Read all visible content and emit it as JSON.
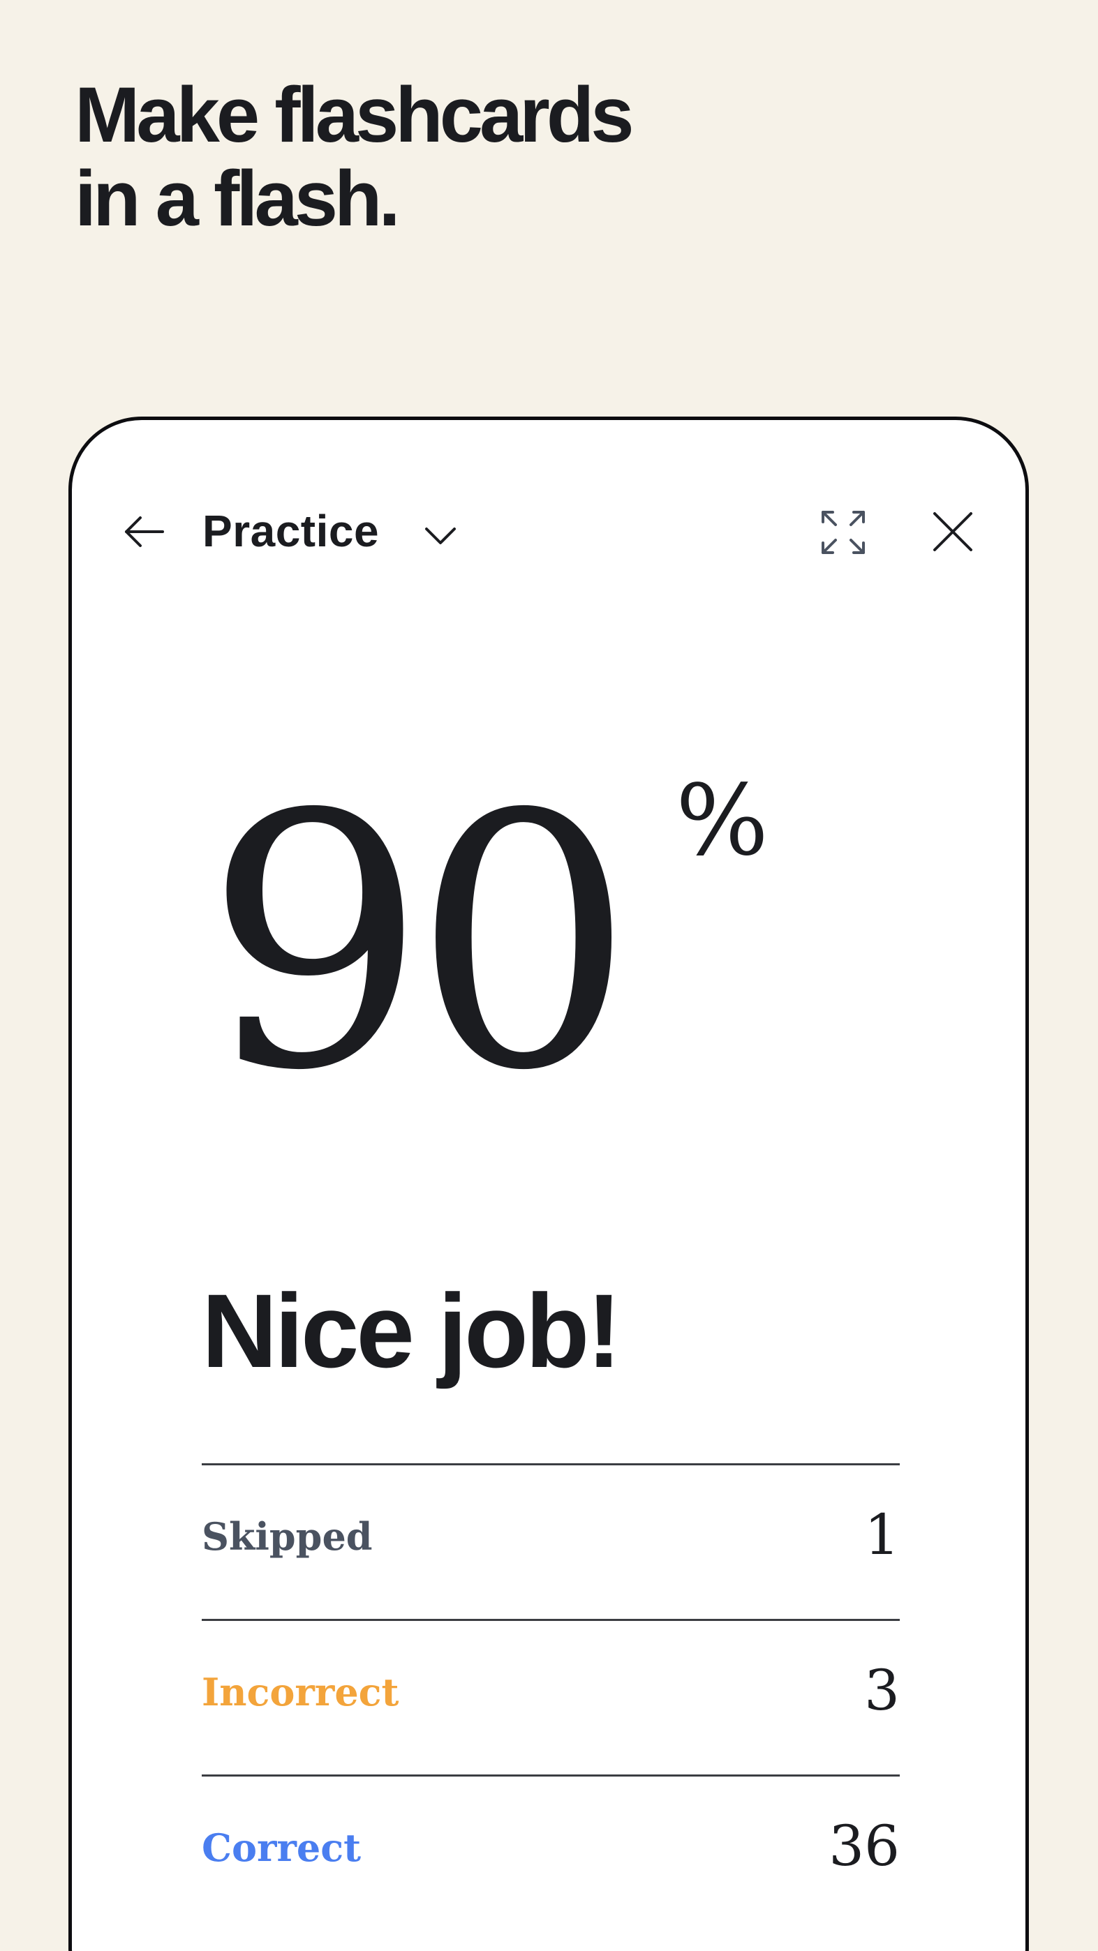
{
  "headline": {
    "line1": "Make flashcards",
    "line2": "in a flash."
  },
  "header": {
    "back_icon": "arrow-left-icon",
    "title": "Practice",
    "dropdown_icon": "chevron-down-icon",
    "expand_icon": "expand-icon",
    "close_icon": "close-icon"
  },
  "result": {
    "score": "90",
    "unit": "%",
    "message": "Nice job!"
  },
  "stats": [
    {
      "label": "Skipped",
      "value": "1",
      "color": "#4a5260"
    },
    {
      "label": "Incorrect",
      "value": "3",
      "color": "#f3a43b"
    },
    {
      "label": "Correct",
      "value": "36",
      "color": "#4a7ef0"
    }
  ]
}
